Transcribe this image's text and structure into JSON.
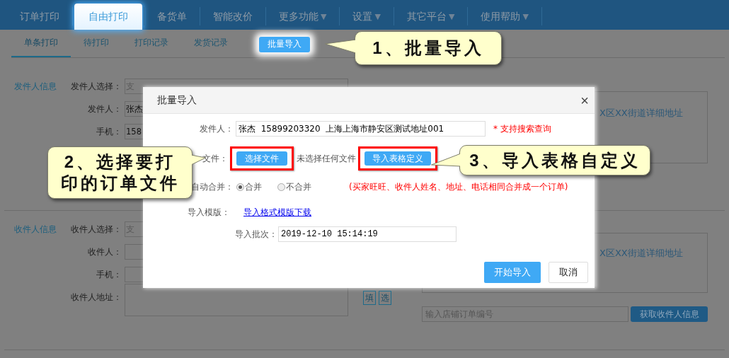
{
  "nav": {
    "items": [
      {
        "label": "订单打印",
        "selected": false
      },
      {
        "label": "自由打印",
        "selected": true
      },
      {
        "label": "备货单",
        "selected": false
      },
      {
        "label": "智能改价",
        "selected": false
      },
      {
        "label": "更多功能",
        "caret": "▼",
        "selected": false
      },
      {
        "label": "设置",
        "caret": "▼",
        "selected": false
      },
      {
        "label": "其它平台",
        "caret": "▼",
        "selected": false
      },
      {
        "label": "使用帮助",
        "caret": "▼",
        "selected": false
      }
    ]
  },
  "subnav": {
    "tabs": [
      {
        "label": "单条打印",
        "selected": true
      },
      {
        "label": "待打印",
        "selected": false
      },
      {
        "label": "打印记录",
        "selected": false
      },
      {
        "label": "发货记录",
        "selected": false
      }
    ],
    "import_button": "批量导入"
  },
  "sender": {
    "title": "发件人信息",
    "fields": [
      {
        "kind": "input",
        "label": "发件人选择：",
        "placeholder": "支"
      },
      {
        "kind": "input",
        "label": "发件人：",
        "value": "张杰"
      },
      {
        "kind": "input",
        "label": "手机：",
        "value": "158"
      }
    ],
    "address_box": {
      "value": "X区XX街道详细地址"
    }
  },
  "receiver": {
    "title": "收件人信息",
    "fields": [
      {
        "kind": "input",
        "label": "收件人选择：",
        "placeholder": "支"
      },
      {
        "kind": "input",
        "label": "收件人："
      },
      {
        "kind": "input",
        "label": "手机："
      },
      {
        "kind": "textarea",
        "label": "收件人地址："
      }
    ],
    "tool_buttons": [
      "填",
      "选"
    ],
    "address_box": {
      "value": "X区XX街道详细地址"
    },
    "order_field": {
      "placeholder": "输入店铺订单编号"
    },
    "fetch_button": "获取收件人信息"
  },
  "dialog": {
    "title": "批量导入",
    "close": "×",
    "sender_label": "发件人：",
    "sender_value": "张杰  15899203320  上海上海市静安区测试地址001",
    "sender_hint": "* 支持搜索查询",
    "file_label": "文件：",
    "choose_button": "选择文件",
    "no_file": "未选择任何文件",
    "define_button": "导入表格定义",
    "merge_label": "自动合并：",
    "merge_options": [
      {
        "label": "合并",
        "selected": true
      },
      {
        "label": "不合并",
        "selected": false
      }
    ],
    "merge_note": "(买家旺旺、收件人姓名、地址、电话相同合并成一个订单)",
    "template_label": "导入模版：",
    "template_link": "导入格式模版下载",
    "batch_label": "导入批次：",
    "batch_value": "2019-12-10 15:14:19",
    "start_button": "开始导入",
    "cancel_button": "取消"
  },
  "callouts": [
    {
      "text": "1、批量导入"
    },
    {
      "text": "2、选择要打印的订单文件"
    },
    {
      "text": "3、导入表格自定义"
    }
  ]
}
